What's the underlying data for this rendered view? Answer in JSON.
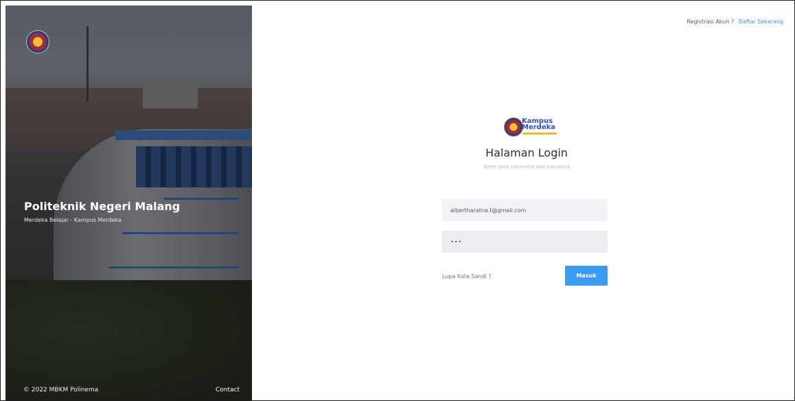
{
  "hero": {
    "title": "Politeknik Negeri Malang",
    "subtitle": "Merdeka Belajar - Kampus Merdeka",
    "copyright": "© 2022 MBKM Polinema",
    "contact": "Contact",
    "logo_icon": "polinema-logo-icon"
  },
  "topbar": {
    "question": "Registrasi Akun ?",
    "register_link": "Daftar Sekarang"
  },
  "brand": {
    "line1": "Kampus",
    "line2": "Merdeka",
    "seal_icon": "kampus-merdeka-logo-icon"
  },
  "login": {
    "heading": "Halaman Login",
    "hint": "Enter your username and password",
    "email_value": "albertharatna.t@gmail.com",
    "password_value": "•••",
    "forgot_label": "Lupa Kata Sandi ?",
    "submit_label": "Masuk"
  },
  "colors": {
    "accent": "#3a9bf0",
    "link": "#3f8ee8",
    "field_bg": "#f1f3f6"
  }
}
